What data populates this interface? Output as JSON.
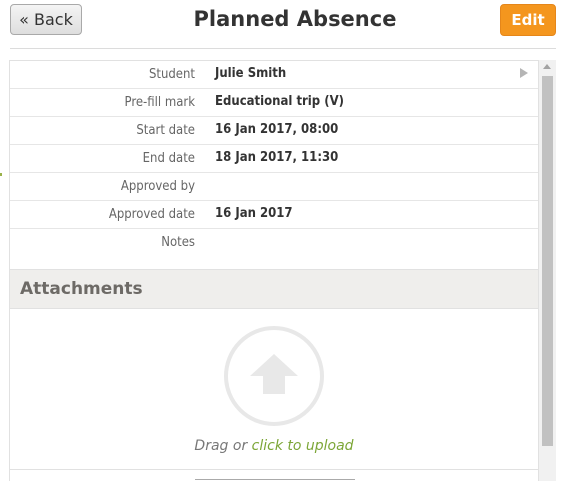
{
  "header": {
    "back_label": "« Back",
    "title": "Planned Absence",
    "edit_label": "Edit"
  },
  "details": {
    "rows": [
      {
        "label": "Student",
        "value": "Julie Smith"
      },
      {
        "label": "Pre-fill mark",
        "value": "Educational trip (V)"
      },
      {
        "label": "Start date",
        "value": "16 Jan 2017, 08:00"
      },
      {
        "label": "End date",
        "value": "18 Jan 2017, 11:30"
      },
      {
        "label": "Approved by",
        "value": ""
      },
      {
        "label": "Approved date",
        "value": "16 Jan 2017"
      },
      {
        "label": "Notes",
        "value": ""
      }
    ]
  },
  "attachments": {
    "heading": "Attachments",
    "drag_text": "Drag or ",
    "upload_link": "click to upload"
  },
  "colors": {
    "accent": "#f4961e",
    "link": "#7ca637"
  }
}
